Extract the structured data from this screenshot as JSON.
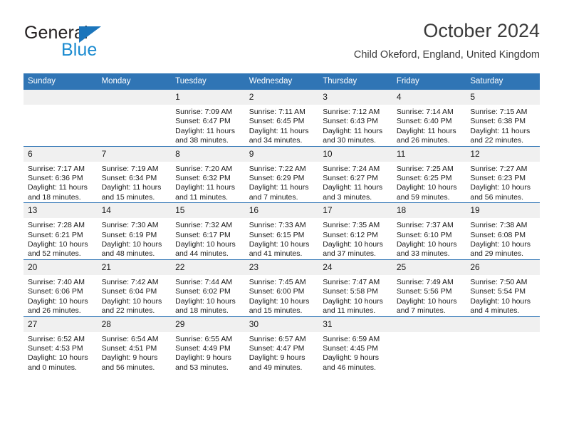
{
  "brand": {
    "name_part1": "General",
    "name_part2": "Blue",
    "triangle_icon": "brand-triangle-icon",
    "accent_dark": "#231f20",
    "accent_blue": "#1b8bd0",
    "triangle_blue": "#1b75bb"
  },
  "header": {
    "title": "October 2024",
    "subtitle": "Child Okeford, England, United Kingdom"
  },
  "theme": {
    "header_blue": "#3075b5",
    "daynum_band": "#f0f0f0",
    "text": "#1a1a1a"
  },
  "calendar": {
    "weekday_headers": [
      "Sunday",
      "Monday",
      "Tuesday",
      "Wednesday",
      "Thursday",
      "Friday",
      "Saturday"
    ],
    "weeks": [
      [
        {
          "day": "",
          "sunrise": "",
          "sunset": "",
          "daylight1": "",
          "daylight2": ""
        },
        {
          "day": "",
          "sunrise": "",
          "sunset": "",
          "daylight1": "",
          "daylight2": ""
        },
        {
          "day": "1",
          "sunrise": "Sunrise: 7:09 AM",
          "sunset": "Sunset: 6:47 PM",
          "daylight1": "Daylight: 11 hours",
          "daylight2": "and 38 minutes."
        },
        {
          "day": "2",
          "sunrise": "Sunrise: 7:11 AM",
          "sunset": "Sunset: 6:45 PM",
          "daylight1": "Daylight: 11 hours",
          "daylight2": "and 34 minutes."
        },
        {
          "day": "3",
          "sunrise": "Sunrise: 7:12 AM",
          "sunset": "Sunset: 6:43 PM",
          "daylight1": "Daylight: 11 hours",
          "daylight2": "and 30 minutes."
        },
        {
          "day": "4",
          "sunrise": "Sunrise: 7:14 AM",
          "sunset": "Sunset: 6:40 PM",
          "daylight1": "Daylight: 11 hours",
          "daylight2": "and 26 minutes."
        },
        {
          "day": "5",
          "sunrise": "Sunrise: 7:15 AM",
          "sunset": "Sunset: 6:38 PM",
          "daylight1": "Daylight: 11 hours",
          "daylight2": "and 22 minutes."
        }
      ],
      [
        {
          "day": "6",
          "sunrise": "Sunrise: 7:17 AM",
          "sunset": "Sunset: 6:36 PM",
          "daylight1": "Daylight: 11 hours",
          "daylight2": "and 18 minutes."
        },
        {
          "day": "7",
          "sunrise": "Sunrise: 7:19 AM",
          "sunset": "Sunset: 6:34 PM",
          "daylight1": "Daylight: 11 hours",
          "daylight2": "and 15 minutes."
        },
        {
          "day": "8",
          "sunrise": "Sunrise: 7:20 AM",
          "sunset": "Sunset: 6:32 PM",
          "daylight1": "Daylight: 11 hours",
          "daylight2": "and 11 minutes."
        },
        {
          "day": "9",
          "sunrise": "Sunrise: 7:22 AM",
          "sunset": "Sunset: 6:29 PM",
          "daylight1": "Daylight: 11 hours",
          "daylight2": "and 7 minutes."
        },
        {
          "day": "10",
          "sunrise": "Sunrise: 7:24 AM",
          "sunset": "Sunset: 6:27 PM",
          "daylight1": "Daylight: 11 hours",
          "daylight2": "and 3 minutes."
        },
        {
          "day": "11",
          "sunrise": "Sunrise: 7:25 AM",
          "sunset": "Sunset: 6:25 PM",
          "daylight1": "Daylight: 10 hours",
          "daylight2": "and 59 minutes."
        },
        {
          "day": "12",
          "sunrise": "Sunrise: 7:27 AM",
          "sunset": "Sunset: 6:23 PM",
          "daylight1": "Daylight: 10 hours",
          "daylight2": "and 56 minutes."
        }
      ],
      [
        {
          "day": "13",
          "sunrise": "Sunrise: 7:28 AM",
          "sunset": "Sunset: 6:21 PM",
          "daylight1": "Daylight: 10 hours",
          "daylight2": "and 52 minutes."
        },
        {
          "day": "14",
          "sunrise": "Sunrise: 7:30 AM",
          "sunset": "Sunset: 6:19 PM",
          "daylight1": "Daylight: 10 hours",
          "daylight2": "and 48 minutes."
        },
        {
          "day": "15",
          "sunrise": "Sunrise: 7:32 AM",
          "sunset": "Sunset: 6:17 PM",
          "daylight1": "Daylight: 10 hours",
          "daylight2": "and 44 minutes."
        },
        {
          "day": "16",
          "sunrise": "Sunrise: 7:33 AM",
          "sunset": "Sunset: 6:15 PM",
          "daylight1": "Daylight: 10 hours",
          "daylight2": "and 41 minutes."
        },
        {
          "day": "17",
          "sunrise": "Sunrise: 7:35 AM",
          "sunset": "Sunset: 6:12 PM",
          "daylight1": "Daylight: 10 hours",
          "daylight2": "and 37 minutes."
        },
        {
          "day": "18",
          "sunrise": "Sunrise: 7:37 AM",
          "sunset": "Sunset: 6:10 PM",
          "daylight1": "Daylight: 10 hours",
          "daylight2": "and 33 minutes."
        },
        {
          "day": "19",
          "sunrise": "Sunrise: 7:38 AM",
          "sunset": "Sunset: 6:08 PM",
          "daylight1": "Daylight: 10 hours",
          "daylight2": "and 29 minutes."
        }
      ],
      [
        {
          "day": "20",
          "sunrise": "Sunrise: 7:40 AM",
          "sunset": "Sunset: 6:06 PM",
          "daylight1": "Daylight: 10 hours",
          "daylight2": "and 26 minutes."
        },
        {
          "day": "21",
          "sunrise": "Sunrise: 7:42 AM",
          "sunset": "Sunset: 6:04 PM",
          "daylight1": "Daylight: 10 hours",
          "daylight2": "and 22 minutes."
        },
        {
          "day": "22",
          "sunrise": "Sunrise: 7:44 AM",
          "sunset": "Sunset: 6:02 PM",
          "daylight1": "Daylight: 10 hours",
          "daylight2": "and 18 minutes."
        },
        {
          "day": "23",
          "sunrise": "Sunrise: 7:45 AM",
          "sunset": "Sunset: 6:00 PM",
          "daylight1": "Daylight: 10 hours",
          "daylight2": "and 15 minutes."
        },
        {
          "day": "24",
          "sunrise": "Sunrise: 7:47 AM",
          "sunset": "Sunset: 5:58 PM",
          "daylight1": "Daylight: 10 hours",
          "daylight2": "and 11 minutes."
        },
        {
          "day": "25",
          "sunrise": "Sunrise: 7:49 AM",
          "sunset": "Sunset: 5:56 PM",
          "daylight1": "Daylight: 10 hours",
          "daylight2": "and 7 minutes."
        },
        {
          "day": "26",
          "sunrise": "Sunrise: 7:50 AM",
          "sunset": "Sunset: 5:54 PM",
          "daylight1": "Daylight: 10 hours",
          "daylight2": "and 4 minutes."
        }
      ],
      [
        {
          "day": "27",
          "sunrise": "Sunrise: 6:52 AM",
          "sunset": "Sunset: 4:53 PM",
          "daylight1": "Daylight: 10 hours",
          "daylight2": "and 0 minutes."
        },
        {
          "day": "28",
          "sunrise": "Sunrise: 6:54 AM",
          "sunset": "Sunset: 4:51 PM",
          "daylight1": "Daylight: 9 hours",
          "daylight2": "and 56 minutes."
        },
        {
          "day": "29",
          "sunrise": "Sunrise: 6:55 AM",
          "sunset": "Sunset: 4:49 PM",
          "daylight1": "Daylight: 9 hours",
          "daylight2": "and 53 minutes."
        },
        {
          "day": "30",
          "sunrise": "Sunrise: 6:57 AM",
          "sunset": "Sunset: 4:47 PM",
          "daylight1": "Daylight: 9 hours",
          "daylight2": "and 49 minutes."
        },
        {
          "day": "31",
          "sunrise": "Sunrise: 6:59 AM",
          "sunset": "Sunset: 4:45 PM",
          "daylight1": "Daylight: 9 hours",
          "daylight2": "and 46 minutes."
        },
        {
          "day": "",
          "sunrise": "",
          "sunset": "",
          "daylight1": "",
          "daylight2": ""
        },
        {
          "day": "",
          "sunrise": "",
          "sunset": "",
          "daylight1": "",
          "daylight2": ""
        }
      ]
    ]
  }
}
